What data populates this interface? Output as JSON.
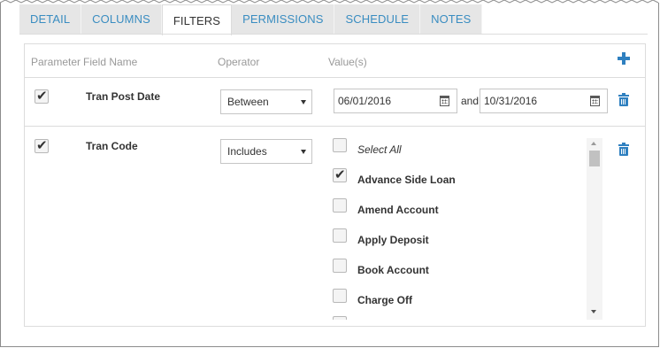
{
  "tabs": [
    {
      "label": "DETAIL",
      "active": false
    },
    {
      "label": "COLUMNS",
      "active": false
    },
    {
      "label": "FILTERS",
      "active": true
    },
    {
      "label": "PERMISSIONS",
      "active": false
    },
    {
      "label": "SCHEDULE",
      "active": false
    },
    {
      "label": "NOTES",
      "active": false
    }
  ],
  "headers": {
    "parameter": "Parameter",
    "field_name": "Field Name",
    "operator": "Operator",
    "values": "Value(s)"
  },
  "icons": {
    "add": "plus-icon",
    "delete": "trash-icon",
    "calendar": "calendar-icon",
    "check": "checkmark-icon"
  },
  "colors": {
    "accent": "#2f80c0",
    "tab_text": "#3a8dc1",
    "tab_bg": "#e6e6e6"
  },
  "filters": [
    {
      "parameter_checked": true,
      "field_name": "Tran Post Date",
      "operator": "Between",
      "value_from": "06/01/2016",
      "and_label": "and",
      "value_to": "10/31/2016"
    },
    {
      "parameter_checked": true,
      "field_name": "Tran Code",
      "operator": "Includes",
      "options": [
        {
          "label": "Select All",
          "checked": false
        },
        {
          "label": "Advance Side Loan",
          "checked": true
        },
        {
          "label": "Amend Account",
          "checked": false
        },
        {
          "label": "Apply Deposit",
          "checked": false
        },
        {
          "label": "Book Account",
          "checked": false
        },
        {
          "label": "Charge Off",
          "checked": false
        }
      ]
    }
  ]
}
